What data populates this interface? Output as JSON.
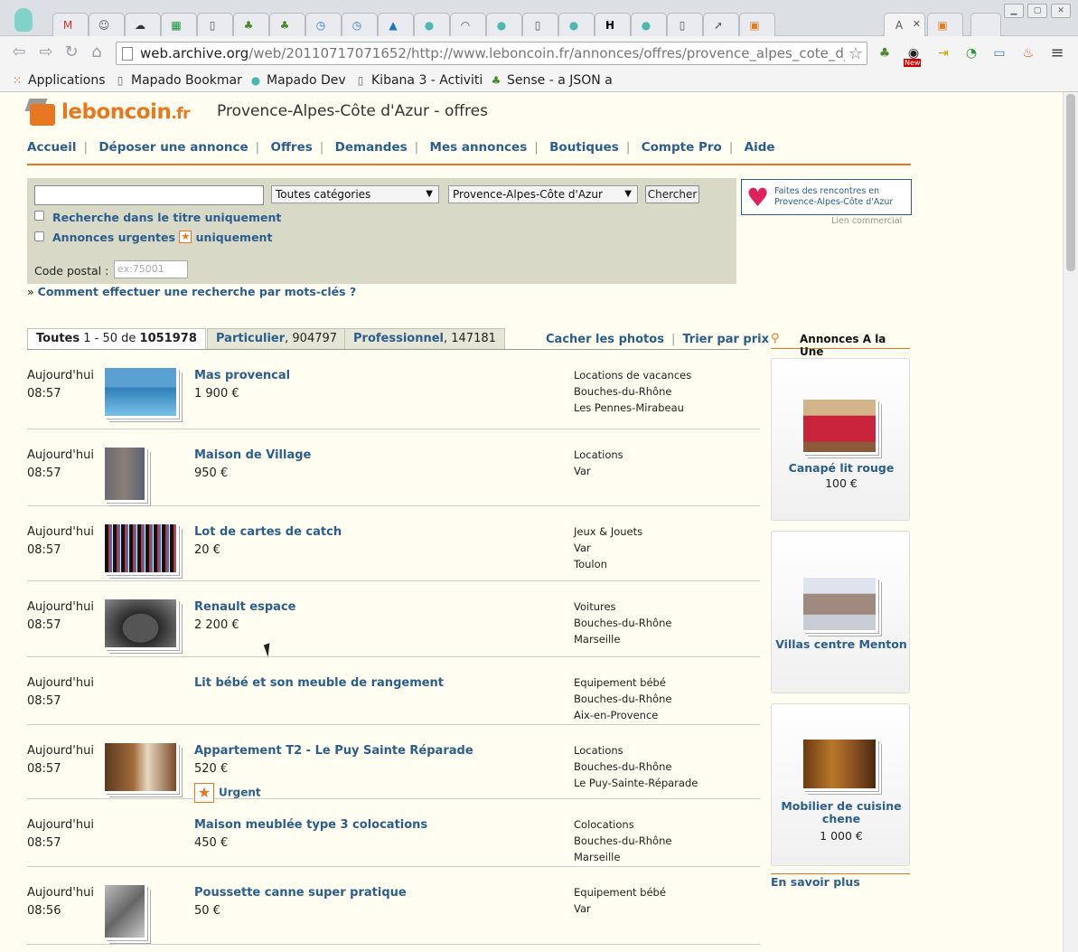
{
  "browser": {
    "url_domain": "web.archive.org",
    "url_rest": "/web/20110717071652/http://www.leboncoin.fr/annonces/offres/provence_alpes_cote_d_a",
    "bookmarks": [
      {
        "label": "Applications",
        "icon": "apps-grid-icon"
      },
      {
        "label": "Mapado Bookmar",
        "icon": "page-icon"
      },
      {
        "label": "Mapado Dev",
        "icon": "mapado-icon"
      },
      {
        "label": "Kibana 3 - Activiti",
        "icon": "page-icon"
      },
      {
        "label": "Sense - a JSON a",
        "icon": "tree-icon"
      }
    ],
    "ext_badge": "New"
  },
  "site": {
    "logo_main": "leboncoin",
    "logo_tld": ".fr",
    "region_title": "Provence-Alpes-Côte d'Azur - offres",
    "nav": [
      "Accueil",
      "Déposer une annonce",
      "Offres",
      "Demandes",
      "Mes annonces",
      "Boutiques",
      "Compte Pro",
      "Aide"
    ]
  },
  "search": {
    "query_value": "",
    "category": "Toutes catégories",
    "region": "Provence-Alpes-Côte d'Azur",
    "submit": "Chercher",
    "title_only": "Recherche dans le titre uniquement",
    "urgent_prefix": "Annonces urgentes",
    "urgent_suffix": "uniquement",
    "postal_label": "Code postal :",
    "postal_placeholder": "ex:75001",
    "howto_prefix": "»",
    "howto": "Comment effectuer une recherche par mots-clés ?"
  },
  "ad": {
    "line1": "Faites des rencontres en",
    "line2": "Provence-Alpes-Côte d'Azur",
    "caption": "Lien commercial"
  },
  "tabs": {
    "all_label": "Toutes",
    "all_range": "1 - 50 de",
    "all_count": "1051978",
    "part_label": "Particulier",
    "part_count": ", 904797",
    "pro_label": "Professionnel",
    "pro_count": ", 147181",
    "hide_photos": "Cacher les photos",
    "sort_price": "Trier par prix"
  },
  "listings": [
    {
      "day": "Aujourd'hui",
      "time": "08:57",
      "title": "Mas provencal",
      "price": "1 900 €",
      "cat": "Locations de vacances",
      "dept": "Bouches-du-Rhône",
      "city": "Les Pennes-Mirabeau",
      "urgent": ""
    },
    {
      "day": "Aujourd'hui",
      "time": "08:57",
      "title": "Maison de Village",
      "price": "950 €",
      "cat": "Locations",
      "dept": "Var",
      "city": "",
      "urgent": ""
    },
    {
      "day": "Aujourd'hui",
      "time": "08:57",
      "title": "Lot de cartes de catch",
      "price": "20 €",
      "cat": "Jeux & Jouets",
      "dept": "Var",
      "city": "Toulon",
      "urgent": ""
    },
    {
      "day": "Aujourd'hui",
      "time": "08:57",
      "title": "Renault espace",
      "price": "2 200 €",
      "cat": "Voitures",
      "dept": "Bouches-du-Rhône",
      "city": "Marseille",
      "urgent": ""
    },
    {
      "day": "Aujourd'hui",
      "time": "08:57",
      "title": "Lit bébé et son meuble de rangement",
      "price": "",
      "cat": "Equipement bébé",
      "dept": "Bouches-du-Rhône",
      "city": "Aix-en-Provence",
      "urgent": ""
    },
    {
      "day": "Aujourd'hui",
      "time": "08:57",
      "title": "Appartement T2 - Le Puy Sainte Réparade",
      "price": "520 €",
      "cat": "Locations",
      "dept": "Bouches-du-Rhône",
      "city": "Le Puy-Sainte-Réparade",
      "urgent": "Urgent"
    },
    {
      "day": "Aujourd'hui",
      "time": "08:57",
      "title": "Maison meublée type 3 colocations",
      "price": "450 €",
      "cat": "Colocations",
      "dept": "Bouches-du-Rhône",
      "city": "Marseille",
      "urgent": ""
    },
    {
      "day": "Aujourd'hui",
      "time": "08:56",
      "title": "Poussette canne super pratique",
      "price": "50 €",
      "cat": "Equipement bébé",
      "dept": "Var",
      "city": "",
      "urgent": ""
    }
  ],
  "featured": {
    "heading": "Annonces A la Une",
    "items": [
      {
        "title": "Canapé lit rouge",
        "price": "100 €"
      },
      {
        "title": "Villas centre Menton",
        "price": ""
      },
      {
        "title": "Mobilier de cuisine chene",
        "price": "1 000 €"
      }
    ],
    "more": "En savoir plus"
  },
  "colors": {
    "accent": "#e8781f",
    "link": "#2b5e8c",
    "page_bg": "#fffef0",
    "search_bg": "#d9d9c8"
  }
}
